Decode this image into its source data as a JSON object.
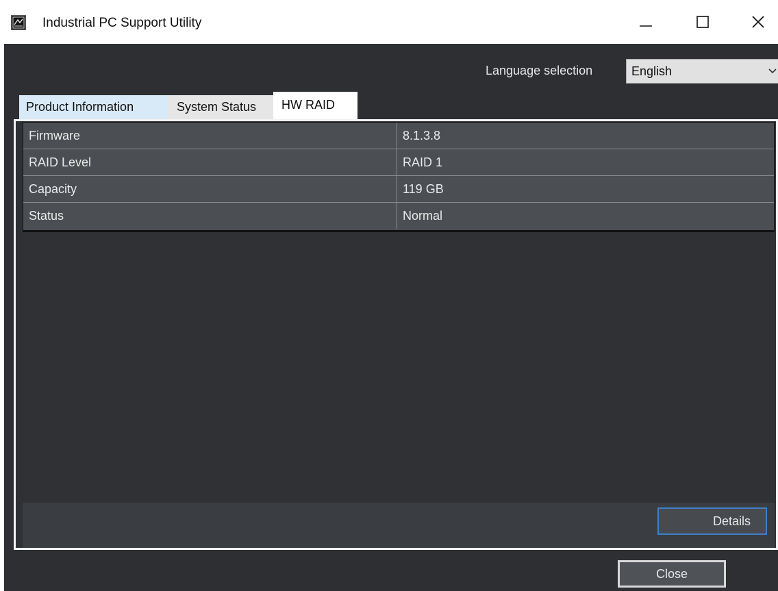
{
  "window": {
    "title": "Industrial PC Support Utility",
    "icon": "app-icon",
    "controls": {
      "minimize_icon": "minimize-icon",
      "maximize_icon": "maximize-icon",
      "close_icon": "close-icon"
    }
  },
  "language": {
    "label": "Language selection",
    "selected": "English",
    "arrow_icon": "chevron-down-icon"
  },
  "tabs": [
    {
      "label": "Product Information",
      "active": false
    },
    {
      "label": "System Status",
      "active": false
    },
    {
      "label": "HW RAID",
      "active": true
    }
  ],
  "raid_table": {
    "rows": [
      {
        "key": "Firmware",
        "value": "8.1.3.8"
      },
      {
        "key": "RAID Level",
        "value": "RAID 1"
      },
      {
        "key": "Capacity",
        "value": "119 GB"
      },
      {
        "key": "Status",
        "value": "Normal"
      }
    ]
  },
  "buttons": {
    "details": "Details",
    "close": "Close"
  },
  "colors": {
    "background": "#2d2f32",
    "table": "#4b4e53",
    "accent": "#3f7fc8"
  }
}
